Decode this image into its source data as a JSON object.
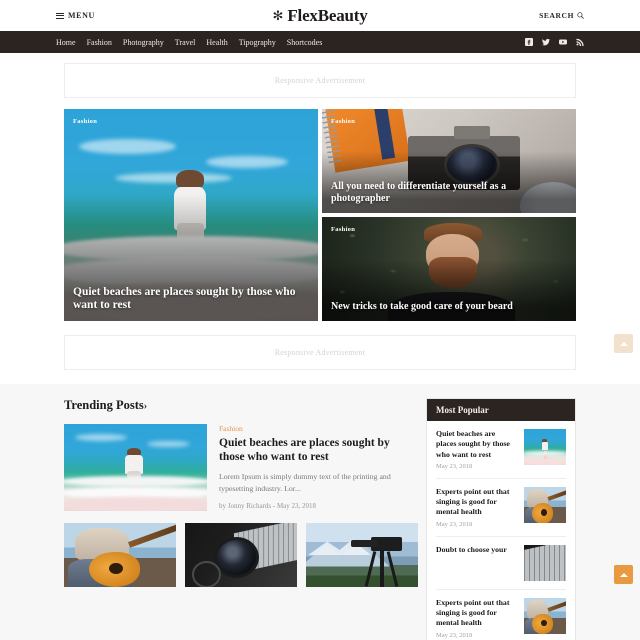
{
  "topbar": {
    "menu_label": "MENU",
    "menu_icon": "hamburger-icon",
    "brand_mark": "✻",
    "brand_name": "FlexBeauty",
    "search_label": "SEARCH",
    "search_icon": "search-icon"
  },
  "nav": {
    "items": [
      {
        "label": "Home"
      },
      {
        "label": "Fashion"
      },
      {
        "label": "Photography"
      },
      {
        "label": "Travel"
      },
      {
        "label": "Health"
      },
      {
        "label": "Tipography"
      },
      {
        "label": "Shortcodes"
      }
    ],
    "social": [
      {
        "name": "facebook-icon"
      },
      {
        "name": "twitter-icon"
      },
      {
        "name": "youtube-icon"
      },
      {
        "name": "rss-icon"
      }
    ],
    "background": "#2b2421"
  },
  "ads": {
    "top_label": "Responsive Advertisement",
    "mid_label": "Responsive Advertisement"
  },
  "featured": {
    "main": {
      "category": "Fashion",
      "title": "Quiet beaches are places sought by those who want to rest"
    },
    "side": [
      {
        "category": "Fashion",
        "title": "All you need to differentiate yourself as a photographer"
      },
      {
        "category": "Fashion",
        "title": "New tricks to take good care of your beard"
      }
    ]
  },
  "trending": {
    "heading": "Trending Posts",
    "chevron": "›",
    "post": {
      "category": "Fashion",
      "title": "Quiet beaches are places sought by those who want to rest",
      "excerpt": "Lorem Ipsum is simply dummy text of the printing and typesetting industry. Lor...",
      "meta": "by Jonny Richards - May 23, 2018"
    },
    "thumbnails": [
      {
        "name": "guitar-player-thumbnail"
      },
      {
        "name": "camera-lens-laptop-thumbnail"
      },
      {
        "name": "camera-tripod-mountains-thumbnail"
      }
    ]
  },
  "sidebar": {
    "widget_title": "Most Popular",
    "items": [
      {
        "title": "Quiet beaches are places sought by those who want to rest",
        "date": "May 23, 2018",
        "thumb": "beach-thumbnail"
      },
      {
        "title": "Experts point out that singing is good for mental health",
        "date": "May 23, 2018",
        "thumb": "guitar-thumbnail"
      },
      {
        "title": "Doubt to choose your",
        "date": "",
        "thumb": "keyboard-thumbnail"
      },
      {
        "title": "Experts point out that singing is good for mental health",
        "date": "May 23, 2018",
        "thumb": "guitar-thumbnail"
      }
    ]
  },
  "scroll_top": {
    "upper_icon": "arrow-up-icon",
    "lower_icon": "arrow-up-icon",
    "upper_color": "#f2e2cd",
    "lower_color": "#e9993f"
  },
  "colors": {
    "accent": "#e2954d",
    "dark": "#2b2421",
    "page_bg": "#f7f7f7"
  }
}
